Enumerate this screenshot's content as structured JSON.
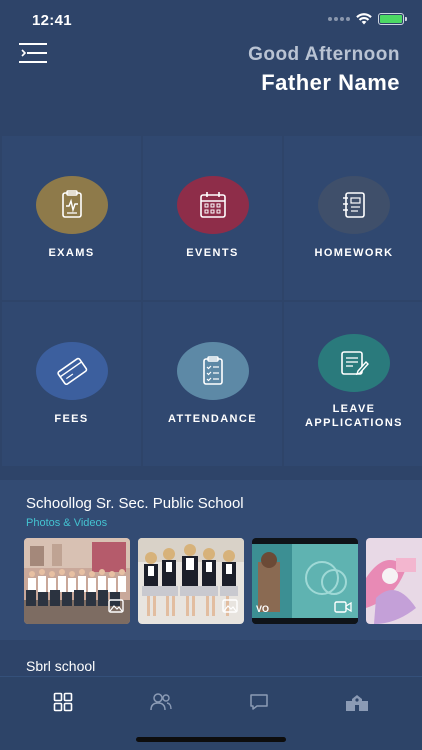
{
  "status": {
    "time": "12:41"
  },
  "header": {
    "greeting": "Good Afternoon",
    "name": "Father Name"
  },
  "tiles": [
    {
      "label": "EXAMS",
      "icon": "exam-icon",
      "color": "#8e7a4a"
    },
    {
      "label": "EVENTS",
      "icon": "calendar-icon",
      "color": "#8e2d49"
    },
    {
      "label": "HOMEWORK",
      "icon": "notebook-icon",
      "color": "#3f4f6a"
    },
    {
      "label": "FEES",
      "icon": "card-icon",
      "color": "#3c5f9e"
    },
    {
      "label": "ATTENDANCE",
      "icon": "clipboard-icon",
      "color": "#5d89a6"
    },
    {
      "label": "LEAVE APPLICATIONS",
      "icon": "document-edit-icon",
      "color": "#2a7a7c"
    }
  ],
  "school": {
    "name": "Schoollog Sr. Sec. Public School",
    "subtitle": "Photos & Videos",
    "media": [
      {
        "type": "photo",
        "icon": "image-icon"
      },
      {
        "type": "photo",
        "icon": "image-icon"
      },
      {
        "type": "video",
        "icon": "video-icon"
      },
      {
        "type": "photo",
        "icon": "image-icon"
      }
    ]
  },
  "school2": {
    "name": "Sbrl school"
  },
  "nav": [
    {
      "name": "dashboard",
      "icon": "grid-icon",
      "active": true
    },
    {
      "name": "people",
      "icon": "users-icon",
      "active": false
    },
    {
      "name": "chat",
      "icon": "chat-icon",
      "active": false
    },
    {
      "name": "school",
      "icon": "school-icon",
      "active": false
    }
  ],
  "colors": {
    "background": "#2e4469",
    "tile": "#304870",
    "accent": "#44c3d1"
  }
}
